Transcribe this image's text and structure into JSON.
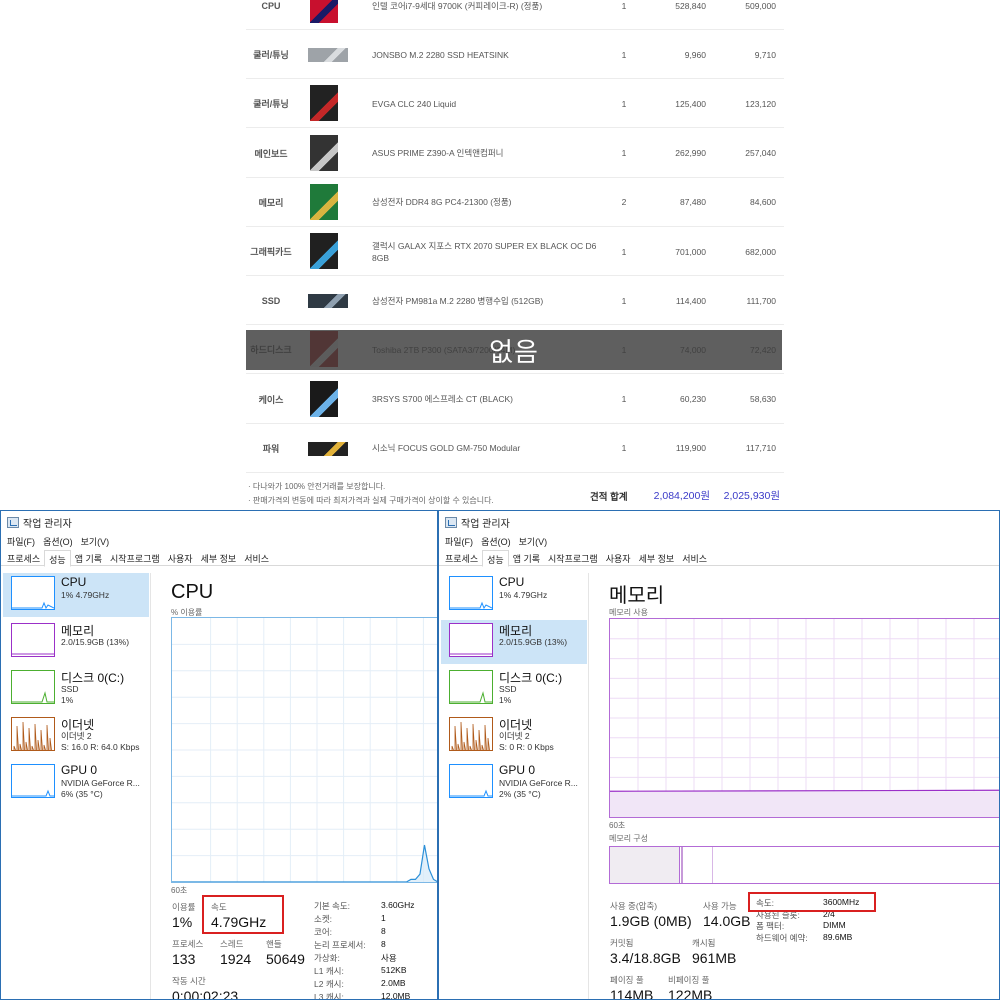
{
  "quote": {
    "rows": [
      {
        "category": "CPU",
        "name": "인텔 코어i7-9세대 9700K (커피레이크-R) (정품)",
        "qty": "1",
        "price1": "528,840",
        "price2": "509,000"
      },
      {
        "category": "쿨러/튜닝",
        "name": "JONSBO M.2 2280 SSD HEATSINK",
        "qty": "1",
        "price1": "9,960",
        "price2": "9,710"
      },
      {
        "category": "쿨러/튜닝",
        "name": "EVGA CLC 240 Liquid",
        "qty": "1",
        "price1": "125,400",
        "price2": "123,120"
      },
      {
        "category": "메인보드",
        "name": "ASUS PRIME Z390-A 인텍앤컴퍼니",
        "qty": "1",
        "price1": "262,990",
        "price2": "257,040"
      },
      {
        "category": "메모리",
        "name": "삼성전자 DDR4 8G PC4-21300 (정품)",
        "qty": "2",
        "price1": "87,480",
        "price2": "84,600"
      },
      {
        "category": "그래픽카드",
        "name": "갤럭시 GALAX 지포스 RTX 2070 SUPER EX BLACK OC D6 8GB",
        "qty": "1",
        "price1": "701,000",
        "price2": "682,000"
      },
      {
        "category": "SSD",
        "name": "삼성전자 PM981a M.2 2280 병행수입 (512GB)",
        "qty": "1",
        "price1": "114,400",
        "price2": "111,700"
      },
      {
        "category": "하드디스크",
        "name": "Toshiba 2TB P300 (SATA3/7200/64M)",
        "qty": "1",
        "price1": "74,000",
        "price2": "72,420"
      },
      {
        "category": "케이스",
        "name": "3RSYS S700 에스프레소 CT (BLACK)",
        "qty": "1",
        "price1": "60,230",
        "price2": "58,630"
      },
      {
        "category": "파워",
        "name": "시소닉 FOCUS GOLD GM-750 Modular",
        "qty": "1",
        "price1": "119,900",
        "price2": "117,710"
      }
    ],
    "overlay_text": "없음",
    "notes": [
      "· 다나와가 100% 안전거래를 보장합니다.",
      "· 판매가격의 변동에 따라 최저가격과 실제 구매가격이 상이할 수 있습니다."
    ],
    "total_label": "견적 합계",
    "total1": "2,084,200원",
    "total2": "2,025,930원"
  },
  "tm_common": {
    "window_title": "작업 관리자",
    "menu": [
      "파일(F)",
      "옵션(O)",
      "보기(V)"
    ],
    "tabs": [
      "프로세스",
      "성능",
      "앱 기록",
      "시작프로그램",
      "사용자",
      "세부 정보",
      "서비스"
    ],
    "sidebar": [
      {
        "title": "CPU",
        "sub1": "1% 4.79GHz",
        "sub2": "",
        "sub3": "",
        "color": "#1e90ff"
      },
      {
        "title": "메모리",
        "sub1": "2.0/15.9GB (13%)",
        "sub2": "",
        "sub3": "",
        "color": "#9b30c8"
      },
      {
        "title": "디스크 0(C:)",
        "sub1": "SSD",
        "sub2": "1%",
        "sub3": "",
        "color": "#4caf30"
      },
      {
        "title": "이더넷",
        "sub1": "이더넷 2",
        "sub2": "",
        "sub3": "",
        "color": "#b05a1a"
      },
      {
        "title": "GPU 0",
        "sub1": "NVIDIA GeForce R...",
        "sub2": "",
        "sub3": "",
        "color": "#1e90ff"
      }
    ]
  },
  "tm1": {
    "ethernet_sub": "S: 16.0 R: 64.0 Kbps",
    "gpu_sub": "6% (35 °C)",
    "title": "CPU",
    "graph_caption": "% 이용률",
    "time_caption": "60초",
    "util_label": "이용률",
    "util_value": "1%",
    "speed_label": "속도",
    "speed_value": "4.79GHz",
    "proc_label": "프로세스",
    "proc_value": "133",
    "thread_label": "스레드",
    "thread_value": "1924",
    "handle_label": "핸들",
    "handle_value": "50649",
    "uptime_label": "작동 시간",
    "uptime_value": "0:00:02:23",
    "specs": [
      {
        "k": "기본 속도:",
        "v": "3.60GHz"
      },
      {
        "k": "소켓:",
        "v": "1"
      },
      {
        "k": "코어:",
        "v": "8"
      },
      {
        "k": "논리 프로세서:",
        "v": "8"
      },
      {
        "k": "가상화:",
        "v": "사용"
      },
      {
        "k": "L1 캐시:",
        "v": "512KB"
      },
      {
        "k": "L2 캐시:",
        "v": "2.0MB"
      },
      {
        "k": "L3 캐시:",
        "v": "12.0MB"
      }
    ],
    "usage_percent_series": [
      0,
      0,
      0,
      0,
      0,
      0,
      0,
      0,
      0,
      0,
      0,
      0,
      0,
      0,
      0,
      0,
      0,
      0,
      0,
      0,
      0,
      0,
      0,
      0,
      0,
      0,
      0,
      0,
      0,
      0,
      0,
      0,
      0,
      0,
      0,
      0,
      0,
      0,
      0,
      0,
      0,
      0,
      0,
      0,
      0,
      0,
      0,
      0,
      0,
      0,
      0,
      0,
      0,
      1,
      1,
      3,
      14,
      5,
      1,
      0
    ]
  },
  "tm2": {
    "ethernet_sub": "S: 0 R: 0 Kbps",
    "gpu_sub": "2% (35 °C)",
    "title": "메모리",
    "graph_caption": "메모리 사용",
    "time_caption": "60초",
    "composition_caption": "메모리 구성",
    "in_use_label": "사용 중(압축)",
    "in_use_value": "1.9GB (0MB)",
    "available_label": "사용 가능",
    "available_value": "14.0GB",
    "committed_label": "커밋됨",
    "committed_value": "3.4/18.8GB",
    "cached_label": "캐시됨",
    "cached_value": "961MB",
    "paged_label": "페이징 풀",
    "paged_value": "114MB",
    "nonpaged_label": "비페이징 풀",
    "nonpaged_value": "122MB",
    "specs": [
      {
        "k": "속도:",
        "v": "3600MHz"
      },
      {
        "k": "사용된 슬롯:",
        "v": "2/4"
      },
      {
        "k": "폼 팩터:",
        "v": "DIMM"
      },
      {
        "k": "하드웨어 예약:",
        "v": "89.6MB"
      }
    ],
    "usage_percent": 13
  }
}
